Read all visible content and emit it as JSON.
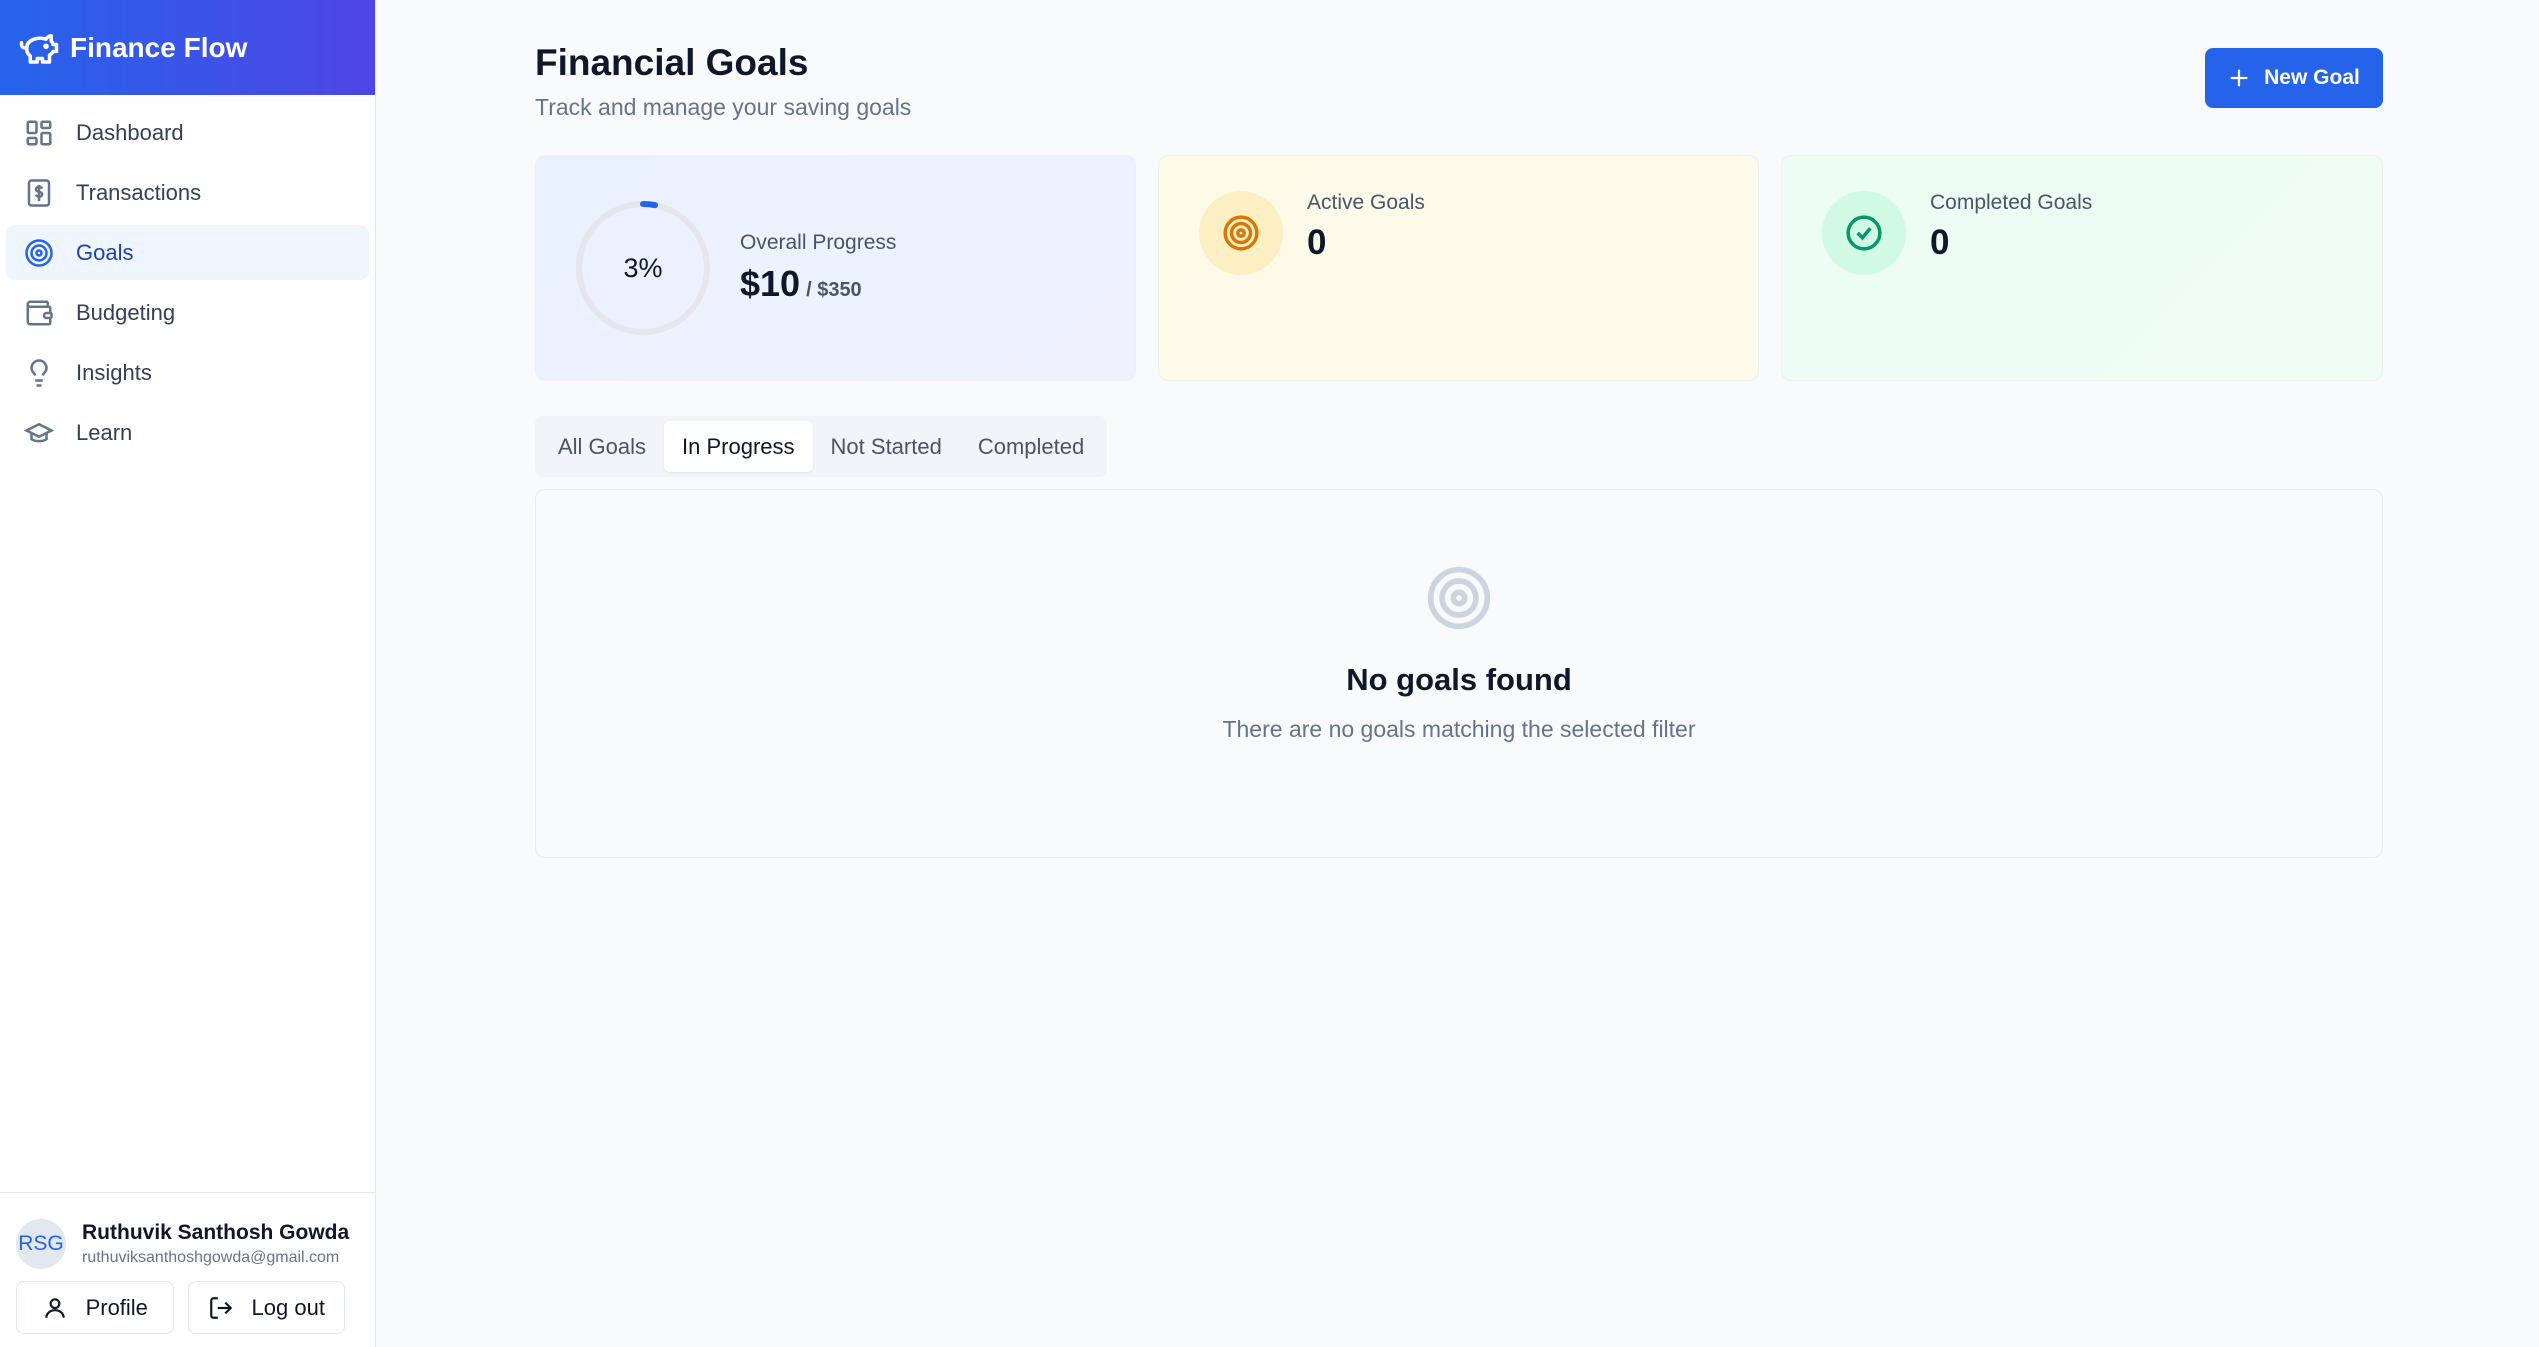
{
  "app": {
    "name": "Finance Flow"
  },
  "nav": {
    "items": [
      {
        "label": "Dashboard",
        "icon": "grid-icon",
        "active": false
      },
      {
        "label": "Transactions",
        "icon": "dollar-receipt-icon",
        "active": false
      },
      {
        "label": "Goals",
        "icon": "target-icon",
        "active": true
      },
      {
        "label": "Budgeting",
        "icon": "wallet-icon",
        "active": false
      },
      {
        "label": "Insights",
        "icon": "lightbulb-icon",
        "active": false
      },
      {
        "label": "Learn",
        "icon": "graduation-cap-icon",
        "active": false
      }
    ]
  },
  "user": {
    "initials": "RSG",
    "name": "Ruthuvik Santhosh Gowda",
    "email": "ruthuviksanthoshgowda@gmail.com",
    "profile_label": "Profile",
    "logout_label": "Log out"
  },
  "header": {
    "title": "Financial Goals",
    "subtitle": "Track and manage your saving goals",
    "new_goal_label": "New Goal"
  },
  "stats": {
    "overall": {
      "label": "Overall Progress",
      "percent_text": "3%",
      "percent": 3,
      "current": "$10",
      "target": "/ $350"
    },
    "active": {
      "label": "Active Goals",
      "value": "0"
    },
    "completed": {
      "label": "Completed Goals",
      "value": "0"
    }
  },
  "tabs": [
    {
      "label": "All Goals",
      "active": false
    },
    {
      "label": "In Progress",
      "active": true
    },
    {
      "label": "Not Started",
      "active": false
    },
    {
      "label": "Completed",
      "active": false
    }
  ],
  "empty": {
    "title": "No goals found",
    "message": "There are no goals matching the selected filter"
  },
  "colors": {
    "primary": "#2563eb",
    "brand_gradient_end": "#4f46e5",
    "active_icon": "#d97706",
    "active_icon_bg": "#fef3c7",
    "completed_icon": "#059669",
    "completed_icon_bg": "#d1fae5",
    "progress_track": "#e5e7eb"
  }
}
